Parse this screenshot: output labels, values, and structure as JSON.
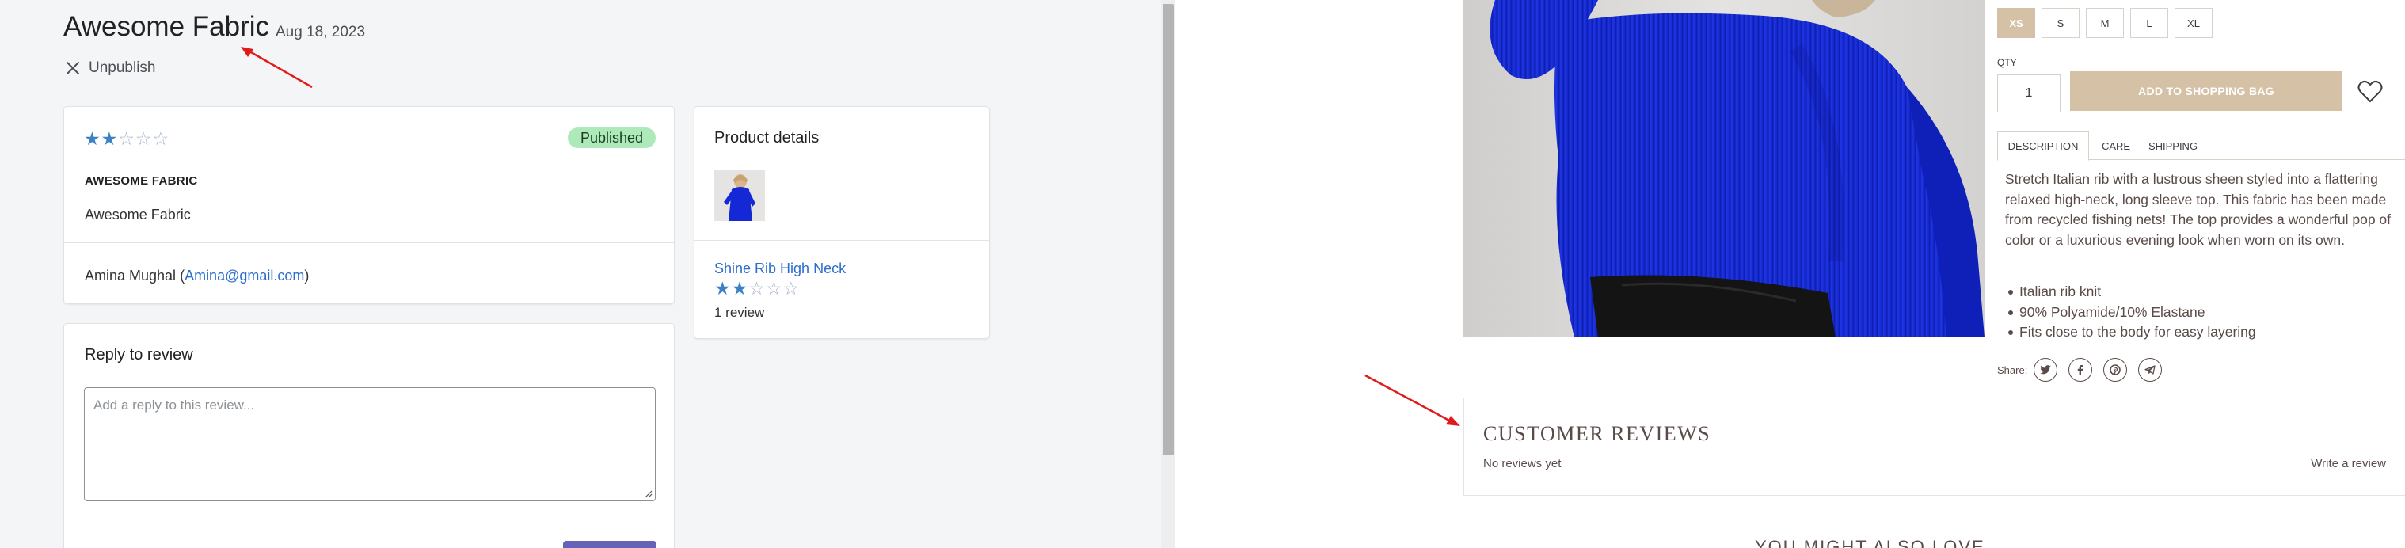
{
  "admin": {
    "review_title": "Awesome Fabric",
    "review_date": "Aug 18, 2023",
    "unpublish_label": "Unpublish",
    "review_card": {
      "rating": 2,
      "max_rating": 5,
      "status_badge": "Published",
      "heading": "AWESOME FABRIC",
      "body": "Awesome Fabric",
      "reviewer_name": "Amina Mughal",
      "reviewer_email": "Amina@gmail.com"
    },
    "reply_card": {
      "title": "Reply to review",
      "placeholder": "Add a reply to this review..."
    },
    "product_details": {
      "title": "Product details",
      "product_name": "Shine Rib High Neck",
      "rating": 2,
      "max_rating": 5,
      "review_count": "1 review"
    }
  },
  "storefront": {
    "sizes": [
      "XS",
      "S",
      "M",
      "L",
      "XL"
    ],
    "selected_size": "XS",
    "qty_label": "QTY",
    "qty_value": "1",
    "add_to_bag_label": "ADD TO SHOPPING BAG",
    "tabs": {
      "description": "DESCRIPTION",
      "care": "CARE",
      "shipping": "SHIPPING"
    },
    "active_tab": "DESCRIPTION",
    "description": "Stretch Italian rib with a lustrous sheen styled into a flattering relaxed high-neck, long sleeve top.  This fabric has been made from recycled fishing nets!  The top provides a wonderful pop of color or a luxurious evening look when worn on its own.",
    "bullets": [
      "Italian rib knit",
      "90% Polyamide/10% Elastane",
      "Fits close to the body for easy layering"
    ],
    "share_label": "Share:",
    "share_icons": [
      "twitter-icon",
      "facebook-icon",
      "pinterest-icon",
      "telegram-icon"
    ],
    "reviews_title": "CUSTOMER REVIEWS",
    "no_reviews": "No reviews yet",
    "write_review": "Write a review",
    "might_also_love": "YOU MIGHT ALSO LOVE"
  },
  "colors": {
    "admin_bg": "#f4f5f7",
    "star_filled": "#3b82c4",
    "badge_bg": "#aee9b9",
    "link": "#2c6ecb",
    "store_accent": "#d5c2a6",
    "store_text": "#5a4b48",
    "annotation_arrow": "#e01b1b",
    "garment_blue": "#1528d6"
  }
}
